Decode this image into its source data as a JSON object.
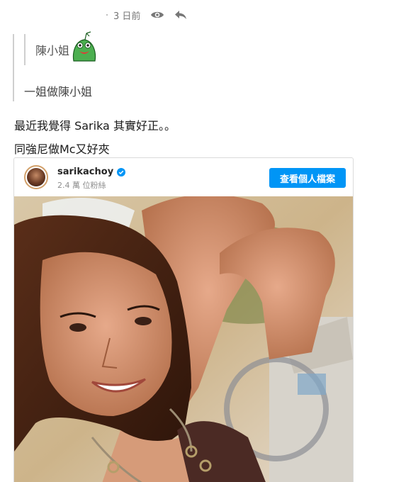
{
  "post_meta": {
    "time": "3 日前",
    "view_icon": "eye-icon",
    "reply_icon": "reply-icon"
  },
  "quote": {
    "inner_text": "陳小姐",
    "outer_text": "一姐做陳小姐",
    "sticker_icon": "green-frog-sticker"
  },
  "post": {
    "line1": "最近我覺得 Sarika 其實好正。。",
    "line2": "同強尼做Mc又好夾"
  },
  "instagram": {
    "username": "sarikachoy",
    "verified_icon": "verified-badge-icon",
    "followers": "2.4 萬 位粉絲",
    "view_profile_label": "查看個人檔案",
    "accent": "#0095f6"
  }
}
